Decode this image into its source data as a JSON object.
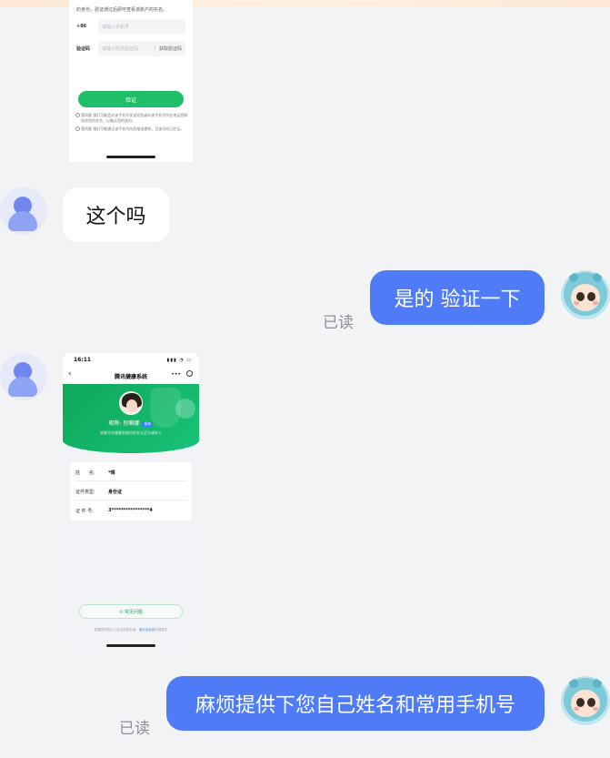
{
  "shot1": {
    "hint": "的身份，验证通过后即可查看该账户的实名。",
    "phone_label": "+86",
    "phone_placeholder": "请输入手机号",
    "code_label": "验证码",
    "code_placeholder": "请输入短信验证码",
    "get_code": "获取验证码",
    "verify_button": "验证",
    "agree_1": "我同意 我们可能会向该手机号发送短信或向该手机号所在地运营商核验您的实名，以确认您的身份。",
    "agree_2": "我同意 我们可能通过该手机号向您推送通知，且该号码已验证。"
  },
  "messages": {
    "m1_text": "这个吗",
    "m2_text": "是的 验证一下",
    "m2_read": "已读",
    "m4_text": "麻烦提供下您自己姓名和常用手机号",
    "m4_read": "已读"
  },
  "shot2": {
    "time": "16:11",
    "signal": "▮▮▮ ◔ ▭",
    "back": "‹",
    "title": "腾讯健康系统",
    "more": "•••",
    "nickname": "昵称: 别嘛娜",
    "badge": "成年",
    "subtitle": "本账号在健康系统内实名认证为成年人",
    "name_label": "姓　　名:",
    "name_value": "*晴",
    "id_type_label": "证件类型:",
    "id_type_value": "身份证",
    "id_no_label": "证 件 号:",
    "id_no_value": "3****************4",
    "faq": "⊙ 常见问题",
    "footer_prefix": "如果您如有以上实名信息有误，",
    "footer_link": "请点击此处",
    "footer_suffix": "申请更正"
  }
}
